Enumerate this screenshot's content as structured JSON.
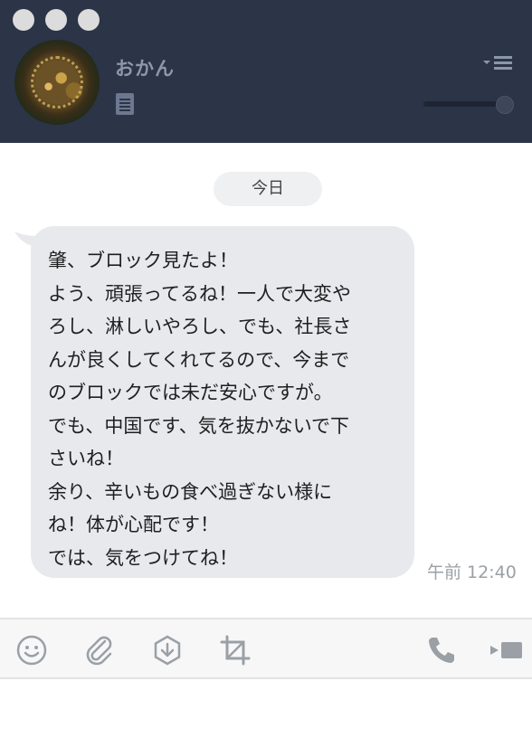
{
  "contact": {
    "name": "おかん"
  },
  "chat": {
    "date_label": "今日",
    "message": {
      "lines": [
        "肇、ブロック見たよ！",
        "よう、頑張ってるね！一人で大変や",
        "ろし、淋しいやろし、でも、社長さ",
        "んが良くしてくれてるので、今まで",
        "のブロックでは未だ安心ですが。",
        "でも、中国です、気を抜かないで下",
        "さいね！",
        "余り、辛いもの食べ過ぎない様に",
        "ね！体が心配です！",
        "では、気をつけてね！"
      ],
      "time": "午前 12:40"
    }
  },
  "toolbar": {
    "icons": [
      "emoji-icon",
      "attach-icon",
      "download-icon",
      "crop-icon",
      "phone-icon",
      "video-icon"
    ]
  },
  "colors": {
    "header_bg": "#2c3447",
    "bubble_bg": "#e7e9ec",
    "icon_gray": "#9aa0a6"
  }
}
